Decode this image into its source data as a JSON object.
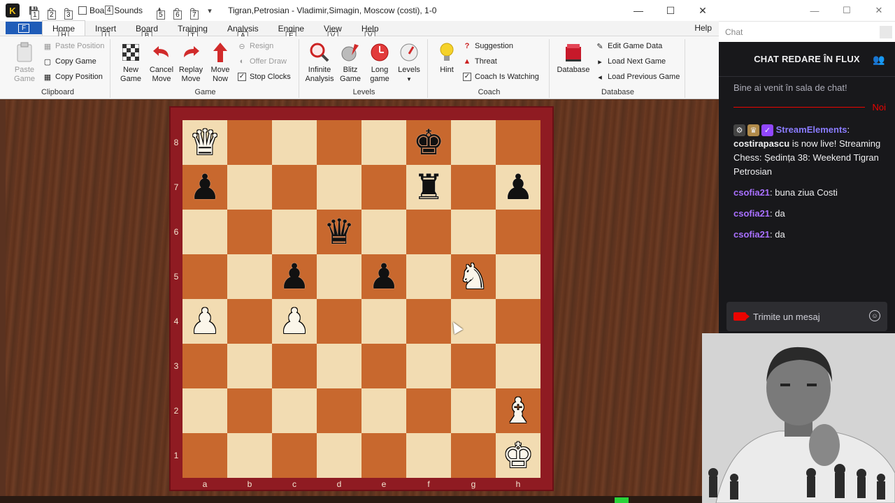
{
  "app": {
    "logo_letter": "K",
    "window_title": "Tigran,Petrosian - Vladimir,Simagin, Moscow  (costi), 1-0",
    "qat_keys": [
      "1",
      "2",
      "3",
      "4",
      "5",
      "6",
      "7"
    ],
    "board_sounds_label": "Board Sounds",
    "minimize": "—",
    "maximize": "☐",
    "close": "✕"
  },
  "menu": {
    "file_label": "F",
    "tabs": [
      {
        "label": "Home",
        "key": "H"
      },
      {
        "label": "Insert",
        "key": "I"
      },
      {
        "label": "Board",
        "key": "B"
      },
      {
        "label": "Training",
        "key": "T"
      },
      {
        "label": "Analysis",
        "key": "A"
      },
      {
        "label": "Engine",
        "key": "E"
      },
      {
        "label": "View",
        "key": "V"
      },
      {
        "label": "Help",
        "key": "V"
      }
    ],
    "help_right": "Help"
  },
  "ribbon": {
    "clipboard": {
      "paste_game": "Paste Game",
      "paste_position": "Paste Position",
      "copy_game": "Copy Game",
      "copy_position": "Copy Position",
      "group_label": "Clipboard"
    },
    "game": {
      "new_game": "New Game",
      "cancel_move": "Cancel Move",
      "replay_move": "Replay Move",
      "move_now": "Move Now",
      "resign": "Resign",
      "offer_draw": "Offer Draw",
      "stop_clocks": "Stop Clocks",
      "group_label": "Game"
    },
    "levels": {
      "infinite_analysis": "Infinite Analysis",
      "blitz_game": "Blitz Game",
      "long_game": "Long game",
      "levels": "Levels",
      "group_label": "Levels"
    },
    "coach": {
      "hint": "Hint",
      "suggestion": "Suggestion",
      "threat": "Threat",
      "coach_watching": "Coach Is Watching",
      "group_label": "Coach"
    },
    "database": {
      "database": "Database",
      "edit_game_data": "Edit Game Data",
      "load_next_game": "Load Next Game",
      "load_previous_game": "Load Previous Game",
      "group_label": "Database"
    }
  },
  "board": {
    "ranks": [
      "8",
      "7",
      "6",
      "5",
      "4",
      "3",
      "2",
      "1"
    ],
    "files": [
      "a",
      "b",
      "c",
      "d",
      "e",
      "f",
      "g",
      "h"
    ],
    "pieces": {
      "a8": "wQ",
      "f8": "bK",
      "a7": "bP",
      "f7": "bR",
      "h7": "bP",
      "d6": "bQ",
      "c5": "bP",
      "e5": "bP",
      "g5": "wN",
      "a4": "wP",
      "c4": "wP",
      "h2": "wB",
      "h1": "wK"
    }
  },
  "chat": {
    "address_placeholder": "Chat",
    "header": "CHAT REDARE ÎN FLUX",
    "welcome": "Bine ai venit în sala de chat!",
    "new_label": "Noi",
    "messages": [
      {
        "user": "StreamElements",
        "text": ""
      },
      {
        "user": "csofia21",
        "text": "buna ziua Costi"
      },
      {
        "user": "csofia21",
        "text": "da"
      },
      {
        "user": "csofia21",
        "text": "da"
      }
    ],
    "se_bold": "costirapascu",
    "se_rest": " is now live! Streaming Chess: Ședința 38: Weekend Tigran Petrosian",
    "input_placeholder": "Trimite un mesaj"
  },
  "colors": {
    "light_square": "#f2dcb2",
    "dark_square": "#c8682e",
    "frame": "#8f1b22",
    "chat_bg": "#18181b",
    "chat_user": "#a970ff",
    "live_red": "#eb0400"
  }
}
